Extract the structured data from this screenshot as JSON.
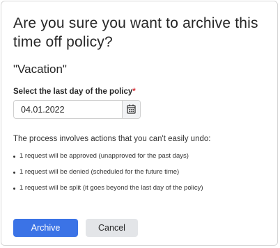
{
  "dialog": {
    "title": "Are you sure you want to archive this time off policy?",
    "policy_name": "\"Vacation\"",
    "field_label": "Select the last day of the policy",
    "required_mark": "*",
    "date_value": "04.01.2022",
    "warning": "The process involves actions that you can't easily undo:",
    "bullets": [
      "1 request will be approved (unapproved for the past days)",
      "1 request will be denied (scheduled for the future time)",
      "1 request will be split (it goes beyond the last day of the policy)"
    ],
    "archive_label": "Archive",
    "cancel_label": "Cancel"
  },
  "icons": {
    "calendar": "calendar-icon"
  },
  "colors": {
    "primary": "#3b73e6",
    "required": "#d9323a",
    "secondary_bg": "#e3e5e8"
  }
}
